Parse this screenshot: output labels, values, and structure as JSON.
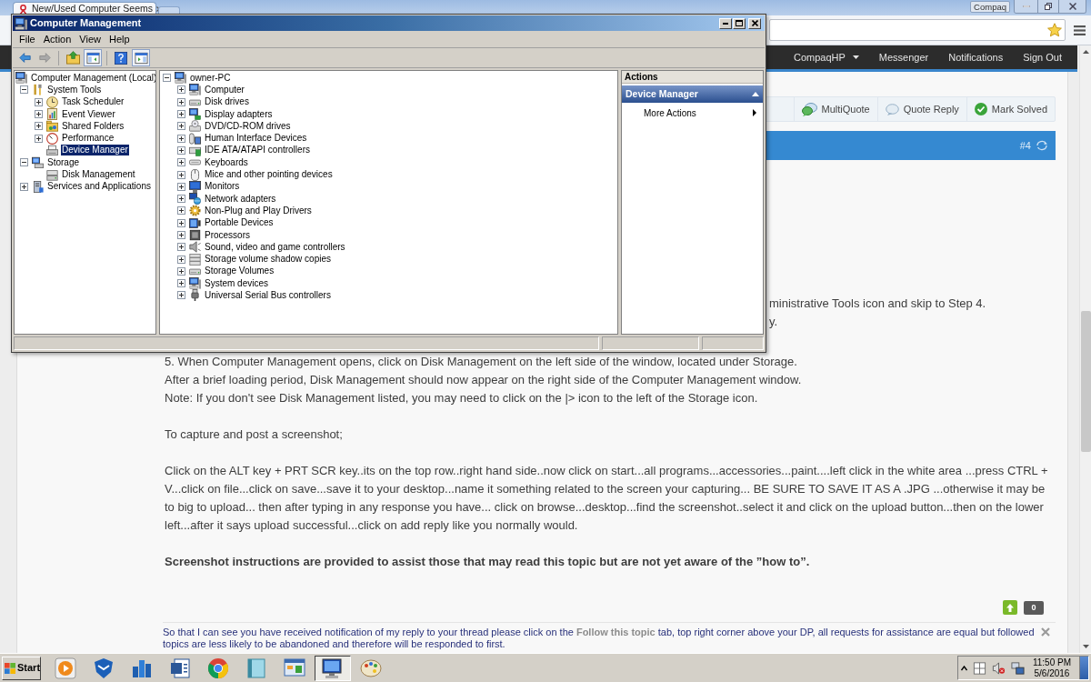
{
  "browser": {
    "tabs": [
      {
        "title": "New/Used Computer Seems",
        "selected": true
      }
    ],
    "profile": "Compaq"
  },
  "site_nav": [
    {
      "label": "CompaqHP",
      "kind": "dropdown"
    },
    {
      "label": "Messenger",
      "kind": "link"
    },
    {
      "label": "Notifications",
      "kind": "link"
    },
    {
      "label": "Sign Out",
      "kind": "link"
    }
  ],
  "post": {
    "actions": [
      "MultiQuote",
      "Quote Reply",
      "Mark Solved"
    ],
    "number": "#4",
    "covered_lines": [
      "ministrative Tools icon and skip to Step 4.",
      "y."
    ],
    "steps": [
      "5. When Computer Management opens, click on Disk Management on the left side of the window, located under Storage.",
      "After a brief loading period, Disk Management should now appear on the right side of the Computer Management window.",
      "Note: If you don't see Disk Management listed, you may need to click on the |> icon to the left of the Storage icon."
    ],
    "paragraphs": [
      "To capture and post a screenshot;",
      "Click on the ALT key + PRT SCR key..its on the top row..right hand side..now click on start...all programs...accessories...paint....left click in the white area ...press CTRL + V...click on file...click on save...save it to your desktop...name it something related to the screen your capturing... BE SURE TO SAVE IT AS A .JPG ...otherwise it may be to big to upload... then after typing in any response you have... click on browse...desktop...find the screenshot..select it and click on the upload button...then on the lower left...after it says upload successful...click on add reply like you normally would."
    ],
    "closing": "Screenshot instructions are provided to assist those that may read this topic but are not yet aware of the ”how to”.",
    "vote_count": "0",
    "notice": "So that I can see you have received notification of my reply to your thread please click on the **Follow this topic** tab, top right corner above your DP, all requests for assistance are equal but followed topics are less likely to be abandoned and therefore will be responded to first."
  },
  "mmc": {
    "title": "Computer Management",
    "menu": [
      "File",
      "Action",
      "View",
      "Help"
    ],
    "toolbar": [
      {
        "disabled": false,
        "pressed": false
      },
      {
        "disabled": true,
        "pressed": false
      },
      {
        "disabled": false,
        "pressed": false
      },
      {
        "disabled": false,
        "pressed": true
      },
      {
        "disabled": false,
        "pressed": false
      },
      {
        "disabled": false,
        "pressed": true
      }
    ],
    "console_tree": {
      "label": "Computer Management (Local)",
      "selected": false,
      "children": [
        {
          "label": "System Tools",
          "expanded": true,
          "selected": false,
          "children": [
            {
              "label": "Task Scheduler",
              "expanded": false,
              "selected": false
            },
            {
              "label": "Event Viewer",
              "expanded": false,
              "selected": false
            },
            {
              "label": "Shared Folders",
              "expanded": false,
              "selected": false
            },
            {
              "label": "Performance",
              "expanded": false,
              "selected": false
            },
            {
              "label": "Device Manager",
              "selected": true
            }
          ]
        },
        {
          "label": "Storage",
          "expanded": true,
          "selected": false,
          "children": [
            {
              "label": "Disk Management",
              "selected": false
            }
          ]
        },
        {
          "label": "Services and Applications",
          "expanded": false,
          "selected": false
        }
      ]
    },
    "device_tree": {
      "label": "owner-PC",
      "expanded": true,
      "children": [
        {
          "label": "Computer",
          "expanded": false
        },
        {
          "label": "Disk drives",
          "expanded": false
        },
        {
          "label": "Display adapters",
          "expanded": false
        },
        {
          "label": "DVD/CD-ROM drives",
          "expanded": false
        },
        {
          "label": "Human Interface Devices",
          "expanded": false
        },
        {
          "label": "IDE ATA/ATAPI controllers",
          "expanded": false
        },
        {
          "label": "Keyboards",
          "expanded": false
        },
        {
          "label": "Mice and other pointing devices",
          "expanded": false
        },
        {
          "label": "Monitors",
          "expanded": false
        },
        {
          "label": "Network adapters",
          "expanded": false
        },
        {
          "label": "Non-Plug and Play Drivers",
          "expanded": false
        },
        {
          "label": "Portable Devices",
          "expanded": false
        },
        {
          "label": "Processors",
          "expanded": false
        },
        {
          "label": "Sound, video and game controllers",
          "expanded": false
        },
        {
          "label": "Storage volume shadow copies",
          "expanded": false
        },
        {
          "label": "Storage Volumes",
          "expanded": false
        },
        {
          "label": "System devices",
          "expanded": false
        },
        {
          "label": "Universal Serial Bus controllers",
          "expanded": false
        }
      ]
    },
    "actions": {
      "title": "Actions",
      "section": "Device Manager",
      "expanded": true,
      "items": [
        "More Actions"
      ]
    }
  },
  "taskbar": {
    "start": "Start",
    "buttons": [
      {
        "selected": false
      },
      {
        "selected": false
      },
      {
        "selected": false
      },
      {
        "selected": false
      },
      {
        "selected": false
      },
      {
        "selected": false
      },
      {
        "selected": false
      },
      {
        "selected": true
      },
      {
        "selected": false
      }
    ],
    "time": "11:50 PM",
    "date": "5/6/2016"
  }
}
